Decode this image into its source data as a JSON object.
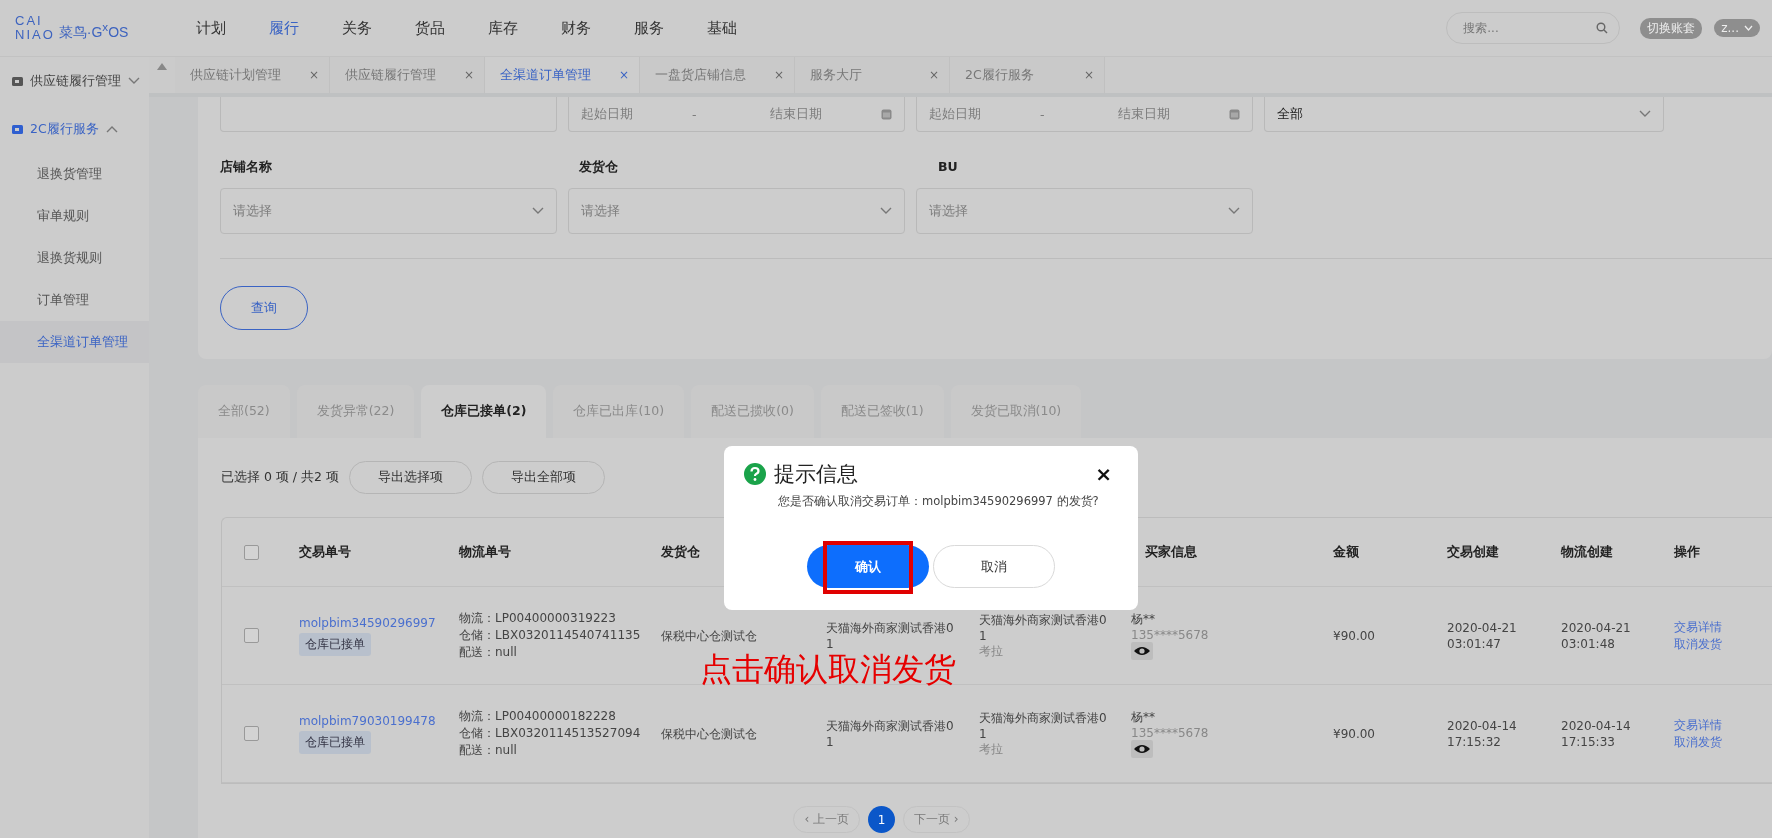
{
  "logo": {
    "top": "CAI",
    "bottom": "NIAO",
    "brand": "菜鸟·G$^{x}$OS"
  },
  "top_nav": [
    {
      "label": "计划",
      "selected": false
    },
    {
      "label": "履行",
      "selected": true
    },
    {
      "label": "关务",
      "selected": false
    },
    {
      "label": "货品",
      "selected": false
    },
    {
      "label": "库存",
      "selected": false
    },
    {
      "label": "财务",
      "selected": false
    },
    {
      "label": "服务",
      "selected": false
    },
    {
      "label": "基础",
      "selected": false
    }
  ],
  "search": {
    "placeholder": "搜索..."
  },
  "account_switch": "切换账套",
  "user_menu": "z...",
  "sidebar": [
    {
      "label": "供应链履行管理",
      "expanded": false
    },
    {
      "label": "2C履行服务",
      "expanded": true,
      "children": [
        {
          "label": "退换货管理",
          "selected": false
        },
        {
          "label": "审单规则",
          "selected": false
        },
        {
          "label": "退换货规则",
          "selected": false
        },
        {
          "label": "订单管理",
          "selected": false
        },
        {
          "label": "全渠道订单管理",
          "selected": true
        }
      ]
    }
  ],
  "page_tabs": [
    {
      "label": "供应链计划管理",
      "close": "×",
      "selected": false
    },
    {
      "label": "供应链履行管理",
      "close": "×",
      "selected": false
    },
    {
      "label": "全渠道订单管理",
      "close": "×",
      "selected": true
    },
    {
      "label": "一盘货店铺信息",
      "close": "×",
      "selected": false
    },
    {
      "label": "服务大厅",
      "close": "×",
      "selected": false
    },
    {
      "label": "2C履行服务",
      "close": "×",
      "selected": false
    }
  ],
  "filters": {
    "row_1": [
      {
        "kind": "text"
      },
      {
        "kind": "daterange",
        "start": "起始日期",
        "sep": "-",
        "end": "结束日期"
      },
      {
        "kind": "daterange",
        "start": "起始日期",
        "sep": "-",
        "end": "结束日期"
      },
      {
        "kind": "select",
        "value": "全部"
      }
    ],
    "row_2": [
      {
        "label": "店铺名称",
        "placeholder": "请选择"
      },
      {
        "label": "发货仓",
        "placeholder": "请选择"
      },
      {
        "label": "BU",
        "placeholder": "请选择"
      }
    ],
    "query_button": "查询"
  },
  "status_tabs": [
    {
      "label": "全部(52)",
      "selected": false
    },
    {
      "label": "发货异常(22)",
      "selected": false
    },
    {
      "label": "仓库已接单(2)",
      "selected": true
    },
    {
      "label": "仓库已出库(10)",
      "selected": false
    },
    {
      "label": "配送已揽收(0)",
      "selected": false
    },
    {
      "label": "配送已签收(1)",
      "selected": false
    },
    {
      "label": "发货已取消(10)",
      "selected": false
    }
  ],
  "selection_info": "已选择 0 项 / 共2 项",
  "export_buttons": [
    "导出选择项",
    "导出全部项"
  ],
  "table": {
    "select_all": {
      "checked": false
    },
    "columns": [
      "交易单号",
      "物流单号",
      "发货仓",
      "",
      "",
      "买家信息",
      "金额",
      "交易创建",
      "物流创建",
      "操作"
    ],
    "rows": [
      {
        "checked": false,
        "order_no": "molpbim34590296997",
        "status": "仓库已接单",
        "logistics": [
          "物流：LP00400000319223",
          "仓储：LBX0320114540741135",
          "配送：null"
        ],
        "warehouse": "保税中心仓测试仓",
        "column_5": [
          "天猫海外商家测试香港0",
          "1"
        ],
        "column_6": [
          "天猫海外商家测试香港0",
          "1",
          "考拉"
        ],
        "buyer": "杨**",
        "phone": "135****5678",
        "amount": "¥90.00",
        "trade_created": "2020-04-21 03:01:47",
        "logistics_created": "2020-04-21 03:01:48",
        "actions": [
          "交易详情",
          "取消发货"
        ]
      },
      {
        "checked": false,
        "order_no": "molpbim79030199478",
        "status": "仓库已接单",
        "logistics": [
          "物流：LP00400000182228",
          "仓储：LBX0320114513527094",
          "配送：null"
        ],
        "warehouse": "保税中心仓测试仓",
        "column_5": [
          "天猫海外商家测试香港0",
          "1"
        ],
        "column_6": [
          "天猫海外商家测试香港0",
          "1",
          "考拉"
        ],
        "buyer": "杨**",
        "phone": "135****5678",
        "amount": "¥90.00",
        "trade_created": "2020-04-14 17:15:32",
        "logistics_created": "2020-04-14 17:15:33",
        "actions": [
          "交易详情",
          "取消发货"
        ]
      }
    ]
  },
  "pagination": [
    {
      "label": "‹ 上一页",
      "kind": "prev",
      "disabled": true
    },
    {
      "label": "1",
      "kind": "page",
      "selected": true
    },
    {
      "label": "下一页 ›",
      "kind": "next",
      "disabled": true
    }
  ],
  "dialog": {
    "title": "提示信息",
    "close": "×",
    "message": "您是否确认取消交易订单：molpbim34590296997 的发货?",
    "confirm": "确认",
    "cancel": "取消"
  },
  "annotation": "点击确认取消发货"
}
